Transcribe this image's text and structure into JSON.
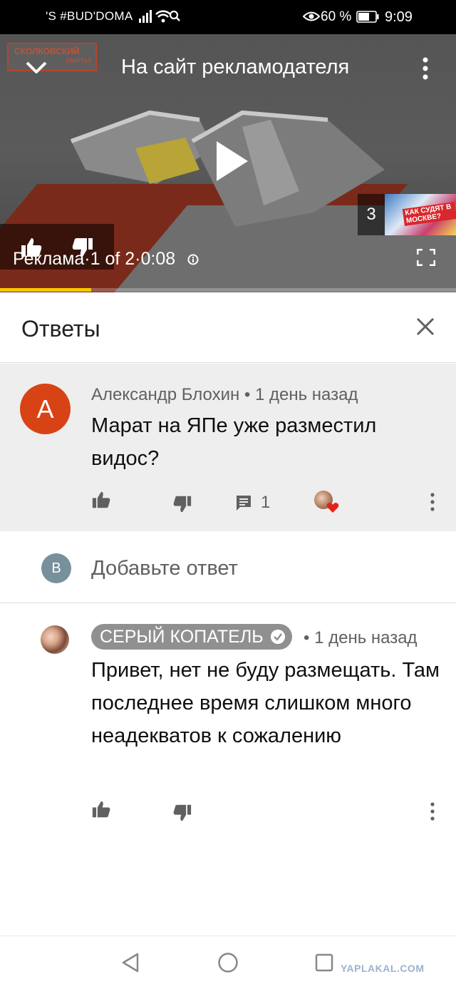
{
  "status_bar": {
    "left_text": "'S #BUD'DOMA",
    "battery_percent": "60 %",
    "time": "9:09"
  },
  "ad": {
    "logo_title": "СКОЛКОВСКИЙ",
    "logo_subtitle": "КВАРТАЛ",
    "title": "На сайт рекламодателя",
    "info": "Реклама·1 of 2·0:08",
    "queue_count": "3",
    "queue_thumb_text": "КАК СУДЯТ В МОСКВЕ?",
    "progress": 0.2
  },
  "replies": {
    "title": "Ответы"
  },
  "parent_comment": {
    "avatar_letter": "А",
    "meta": "Александр Блохин • 1 день назад",
    "text": "Марат на ЯПе уже разместил видос?",
    "reply_count": "1"
  },
  "add_reply": {
    "avatar_letter": "B",
    "placeholder": "Добавьте ответ"
  },
  "reply_comment": {
    "author": "СЕРЫЙ КОПАТЕЛЬ",
    "time": "• 1 день назад",
    "text": "Привет, нет не буду размещать. Там последнее время слишком много неадекватов к сожалению"
  },
  "watermark": "YAPLAKAL.COM",
  "icons": [
    "wifi-icon",
    "search-icon",
    "eye-icon",
    "battery-icon",
    "chevron-down-icon",
    "more-icon",
    "play-icon",
    "like-icon",
    "dislike-icon",
    "info-icon",
    "fullscreen-icon",
    "close-icon",
    "reply-icon",
    "heart-icon",
    "verified-icon",
    "back-icon",
    "home-icon",
    "recents-icon"
  ]
}
